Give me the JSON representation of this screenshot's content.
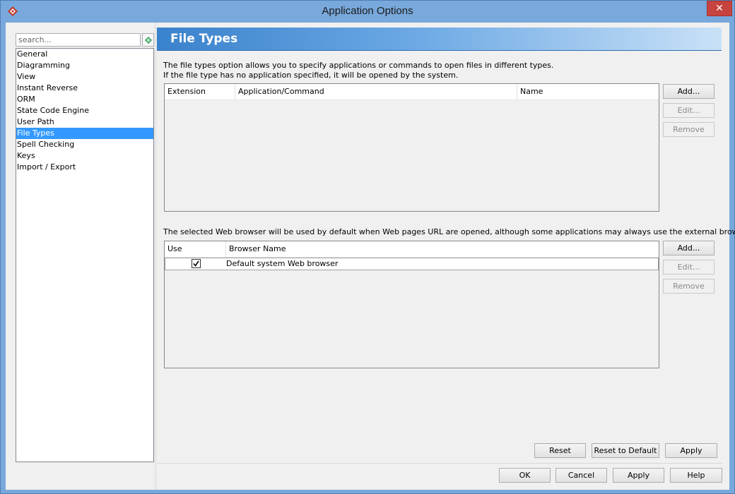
{
  "window": {
    "title": "Application Options",
    "close_glyph": "✕"
  },
  "search": {
    "placeholder": "search..."
  },
  "nav": {
    "items": [
      "General",
      "Diagramming",
      "View",
      "Instant Reverse",
      "ORM",
      "State Code Engine",
      "User Path",
      "File Types",
      "Spell Checking",
      "Keys",
      "Import / Export"
    ],
    "selected": "File Types"
  },
  "panel": {
    "title": "File Types",
    "description_line1": "The file types option allows you to specify applications or commands to open files in different types.",
    "description_line2": "If the file type has no application specified, it will be opened by the system."
  },
  "file_types_table": {
    "columns": [
      "Extension",
      "Application/Command",
      "Name"
    ],
    "rows": []
  },
  "file_types_buttons": {
    "add": "Add...",
    "edit": "Edit...",
    "remove": "Remove"
  },
  "browser_description": "The selected Web browser will be used by default when Web pages URL are opened, although some applications may always use the external browser.",
  "browser_table": {
    "columns": [
      "Use",
      "Browser Name"
    ],
    "rows": [
      {
        "use": true,
        "name": "Default system Web browser"
      }
    ]
  },
  "browser_buttons": {
    "add": "Add...",
    "edit": "Edit...",
    "remove": "Remove"
  },
  "panel_buttons": {
    "reset": "Reset",
    "reset_default": "Reset to Default",
    "apply": "Apply"
  },
  "dialog_buttons": {
    "ok": "OK",
    "cancel": "Cancel",
    "apply": "Apply",
    "help": "Help"
  },
  "colors": {
    "accent": "#3399ff",
    "banner_start": "#3a82cc",
    "titlebar": "#78a8dc",
    "close": "#c7433f"
  }
}
